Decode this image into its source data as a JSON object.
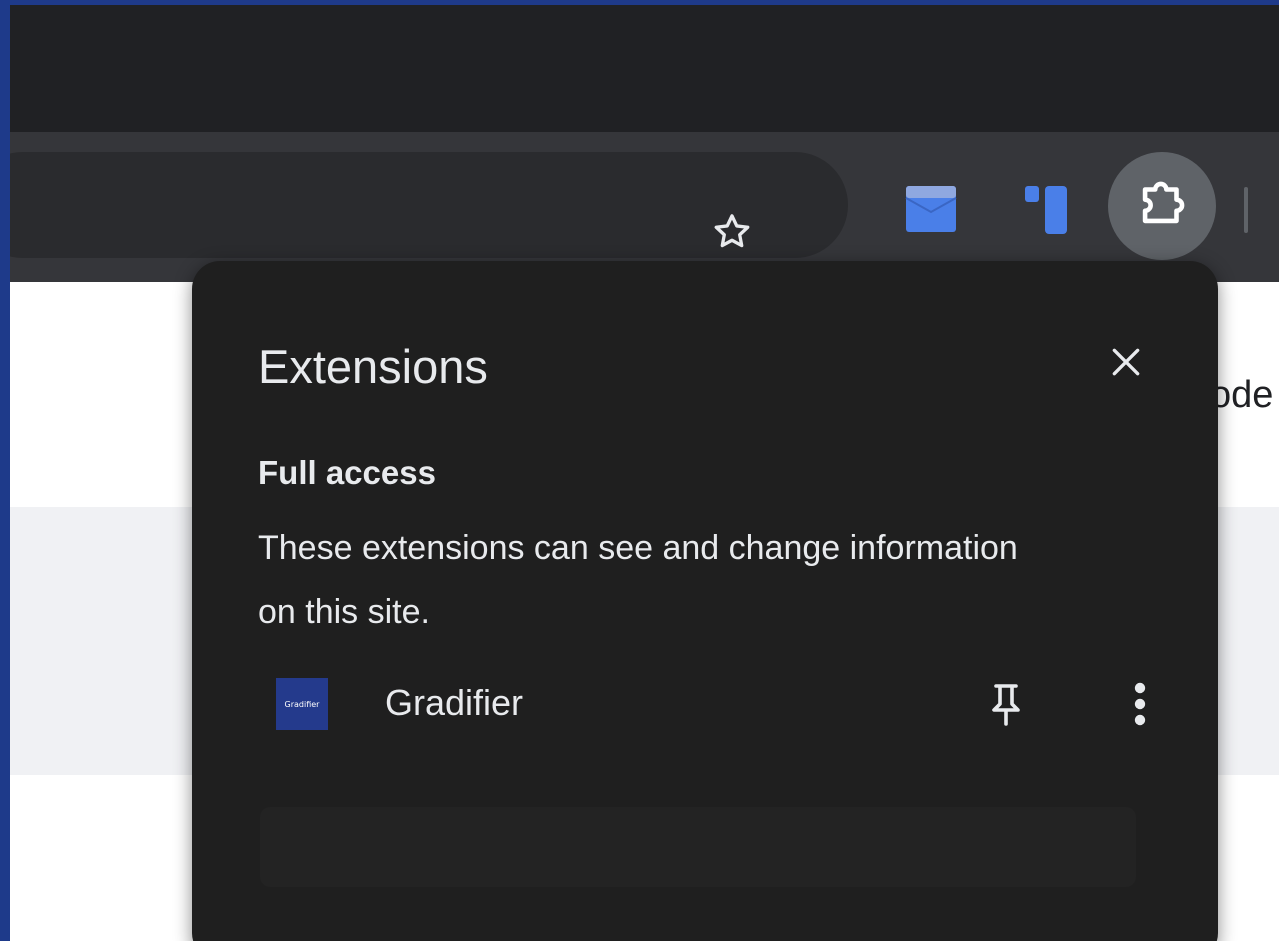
{
  "browser": {
    "page_text_partial": "ode"
  },
  "toolbar": {
    "bookmark_icon": "star-icon",
    "extensions_icon": "puzzle-icon"
  },
  "extensions_popup": {
    "title": "Extensions",
    "close_icon": "close-icon",
    "section": {
      "heading": "Full access",
      "description": "These extensions can see and change information on this site."
    },
    "items": [
      {
        "name": "Gradifier",
        "logo_text": "Gradifier",
        "pin_icon": "pin-icon",
        "more_icon": "more-vert-icon"
      }
    ]
  },
  "colors": {
    "outer_border": "#1e3a8a",
    "popup_bg": "#1f1f1f",
    "toolbar_bg": "#35363a",
    "accent_blue": "#4285f4"
  }
}
